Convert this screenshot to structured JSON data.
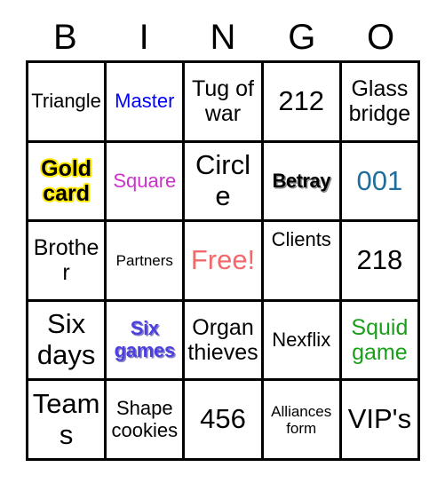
{
  "card": {
    "title": "BINGO",
    "header_letters": [
      "B",
      "I",
      "N",
      "G",
      "O"
    ],
    "rows": 5,
    "columns": 5,
    "colors": {
      "black": "#000000",
      "blue": "#0000ff",
      "magenta": "#cc33cc",
      "teal": "#1f6f9a",
      "salmon": "#f4676b",
      "green": "#1b9e1b",
      "indigo": "#4b3fe0",
      "gold_outline": "#ffe800",
      "grid_line": "#000000",
      "background": "#ffffff"
    },
    "cells": [
      {
        "text": "Triangle",
        "color": "black",
        "size": "md",
        "effect": "none"
      },
      {
        "text": "Master",
        "color": "blue",
        "size": "md",
        "effect": "none"
      },
      {
        "text": "Tug of war",
        "color": "black",
        "size": "lg",
        "effect": "none"
      },
      {
        "text": "212",
        "color": "black",
        "size": "xl",
        "effect": "none"
      },
      {
        "text": "Glass bridge",
        "color": "black",
        "size": "lg",
        "effect": "none"
      },
      {
        "text": "Gold card",
        "color": "black",
        "size": "lg",
        "effect": "gold-outline"
      },
      {
        "text": "Square",
        "color": "magenta",
        "size": "md",
        "effect": "none"
      },
      {
        "text": "Circle",
        "color": "black",
        "size": "xl",
        "effect": "none"
      },
      {
        "text": "Betray",
        "color": "black",
        "size": "md",
        "effect": "black-shadow"
      },
      {
        "text": "001",
        "color": "teal",
        "size": "xl",
        "effect": "none"
      },
      {
        "text": "Brother",
        "color": "black",
        "size": "lg",
        "effect": "none"
      },
      {
        "text": "Partners",
        "color": "black",
        "size": "sm",
        "effect": "none"
      },
      {
        "text": "Free!",
        "color": "salmon",
        "size": "xl",
        "effect": "none"
      },
      {
        "text": "Clients",
        "color": "black",
        "size": "md",
        "effect": "none"
      },
      {
        "text": "218",
        "color": "black",
        "size": "xl",
        "effect": "none"
      },
      {
        "text": "Six days",
        "color": "black",
        "size": "xl",
        "effect": "none"
      },
      {
        "text": "Six games",
        "color": "indigo",
        "size": "md",
        "effect": "indigo-shadow"
      },
      {
        "text": "Organ thieves",
        "color": "black",
        "size": "lg",
        "effect": "none"
      },
      {
        "text": "Nexflix",
        "color": "black",
        "size": "md",
        "effect": "none"
      },
      {
        "text": "Squid game",
        "color": "green",
        "size": "lg",
        "effect": "none"
      },
      {
        "text": "Teams",
        "color": "black",
        "size": "xl",
        "effect": "none"
      },
      {
        "text": "Shape cookies",
        "color": "black",
        "size": "md",
        "effect": "none"
      },
      {
        "text": "456",
        "color": "black",
        "size": "xl",
        "effect": "none"
      },
      {
        "text": "Alliances form",
        "color": "black",
        "size": "sm",
        "effect": "none"
      },
      {
        "text": "VIP's",
        "color": "black",
        "size": "xl",
        "effect": "none"
      }
    ]
  }
}
